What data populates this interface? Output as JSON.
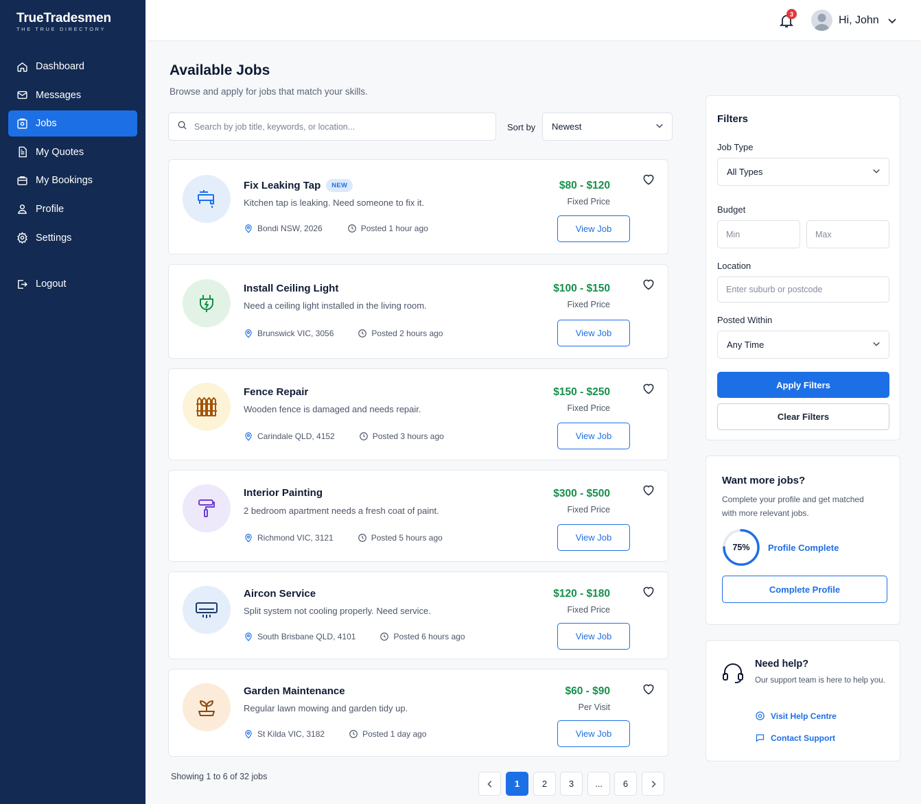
{
  "brand": {
    "title": "TrueTradesmen",
    "subtitle": "THE TRUE DIRECTORY"
  },
  "sidebar": {
    "items": [
      {
        "label": "Dashboard",
        "icon": "home-icon"
      },
      {
        "label": "Messages",
        "icon": "mail-icon"
      },
      {
        "label": "Jobs",
        "icon": "briefcase-icon",
        "active": true
      },
      {
        "label": "My Quotes",
        "icon": "document-icon"
      },
      {
        "label": "My Bookings",
        "icon": "calendar-icon"
      },
      {
        "label": "Profile",
        "icon": "user-icon"
      },
      {
        "label": "Settings",
        "icon": "gear-icon"
      }
    ],
    "logout": "Logout"
  },
  "header": {
    "notifications_count": "3",
    "greeting": "Hi, John"
  },
  "main": {
    "title": "Available Jobs",
    "subtitle": "Browse and apply for jobs that match your skills.",
    "search_placeholder": "Search by job title, keywords, or location...",
    "sort_label": "Sort by",
    "sort_value": "Newest",
    "view_label": "View Job",
    "jobs": [
      {
        "title": "Fix Leaking Tap",
        "badge": "NEW",
        "desc": "Kitchen tap is leaking. Need someone to fix it.",
        "location": "Bondi NSW, 2026",
        "posted": "Posted 1 hour ago",
        "price": "$80 - $120",
        "price_type": "Fixed Price",
        "icon": "tap-icon"
      },
      {
        "title": "Install Ceiling Light",
        "desc": "Need a ceiling light installed in the living room.",
        "location": "Brunswick VIC, 3056",
        "posted": "Posted 2 hours ago",
        "price": "$100 - $150",
        "price_type": "Fixed Price",
        "icon": "plug-icon"
      },
      {
        "title": "Fence Repair",
        "desc": "Wooden fence is damaged and needs repair.",
        "location": "Carindale QLD, 4152",
        "posted": "Posted 3 hours ago",
        "price": "$150 - $250",
        "price_type": "Fixed Price",
        "icon": "fence-icon"
      },
      {
        "title": "Interior Painting",
        "desc": "2 bedroom apartment needs a fresh coat of paint.",
        "location": "Richmond VIC, 3121",
        "posted": "Posted 5 hours ago",
        "price": "$300 - $500",
        "price_type": "Fixed Price",
        "icon": "paint-roller-icon"
      },
      {
        "title": "Aircon Service",
        "desc": "Split system not cooling properly. Need service.",
        "location": "South Brisbane QLD, 4101",
        "posted": "Posted 6 hours ago",
        "price": "$120 - $180",
        "price_type": "Fixed Price",
        "icon": "aircon-icon"
      },
      {
        "title": "Garden Maintenance",
        "desc": "Regular lawn mowing and garden tidy up.",
        "location": "St Kilda VIC, 3182",
        "posted": "Posted 1 day ago",
        "price": "$60 - $90",
        "price_type": "Per Visit",
        "icon": "plant-icon"
      }
    ],
    "showing": "Showing 1 to 6 of 32 jobs",
    "pages": [
      "1",
      "2",
      "3",
      "...",
      "6"
    ],
    "current_page": "1"
  },
  "filters": {
    "title": "Filters",
    "job_type_label": "Job Type",
    "job_type_value": "All Types",
    "budget_label": "Budget",
    "budget_min_placeholder": "Min",
    "budget_max_placeholder": "Max",
    "location_label": "Location",
    "location_placeholder": "Enter suburb or postcode",
    "posted_label": "Posted Within",
    "posted_value": "Any Time",
    "apply": "Apply Filters",
    "clear": "Clear Filters"
  },
  "more_jobs": {
    "title": "Want more jobs?",
    "text": "Complete your profile and get matched with more relevant jobs.",
    "progress_label": "75%",
    "progress": 0.75,
    "status": "Profile Complete",
    "button": "Complete Profile"
  },
  "help": {
    "title": "Need help?",
    "text": "Our support team is here to help you.",
    "link1": "Visit Help Centre",
    "link2": "Contact Support"
  },
  "colors": {
    "sidebar": "#132a52",
    "accent": "#1d6fe6",
    "price": "#15904a",
    "badge": "#e03a3a"
  }
}
